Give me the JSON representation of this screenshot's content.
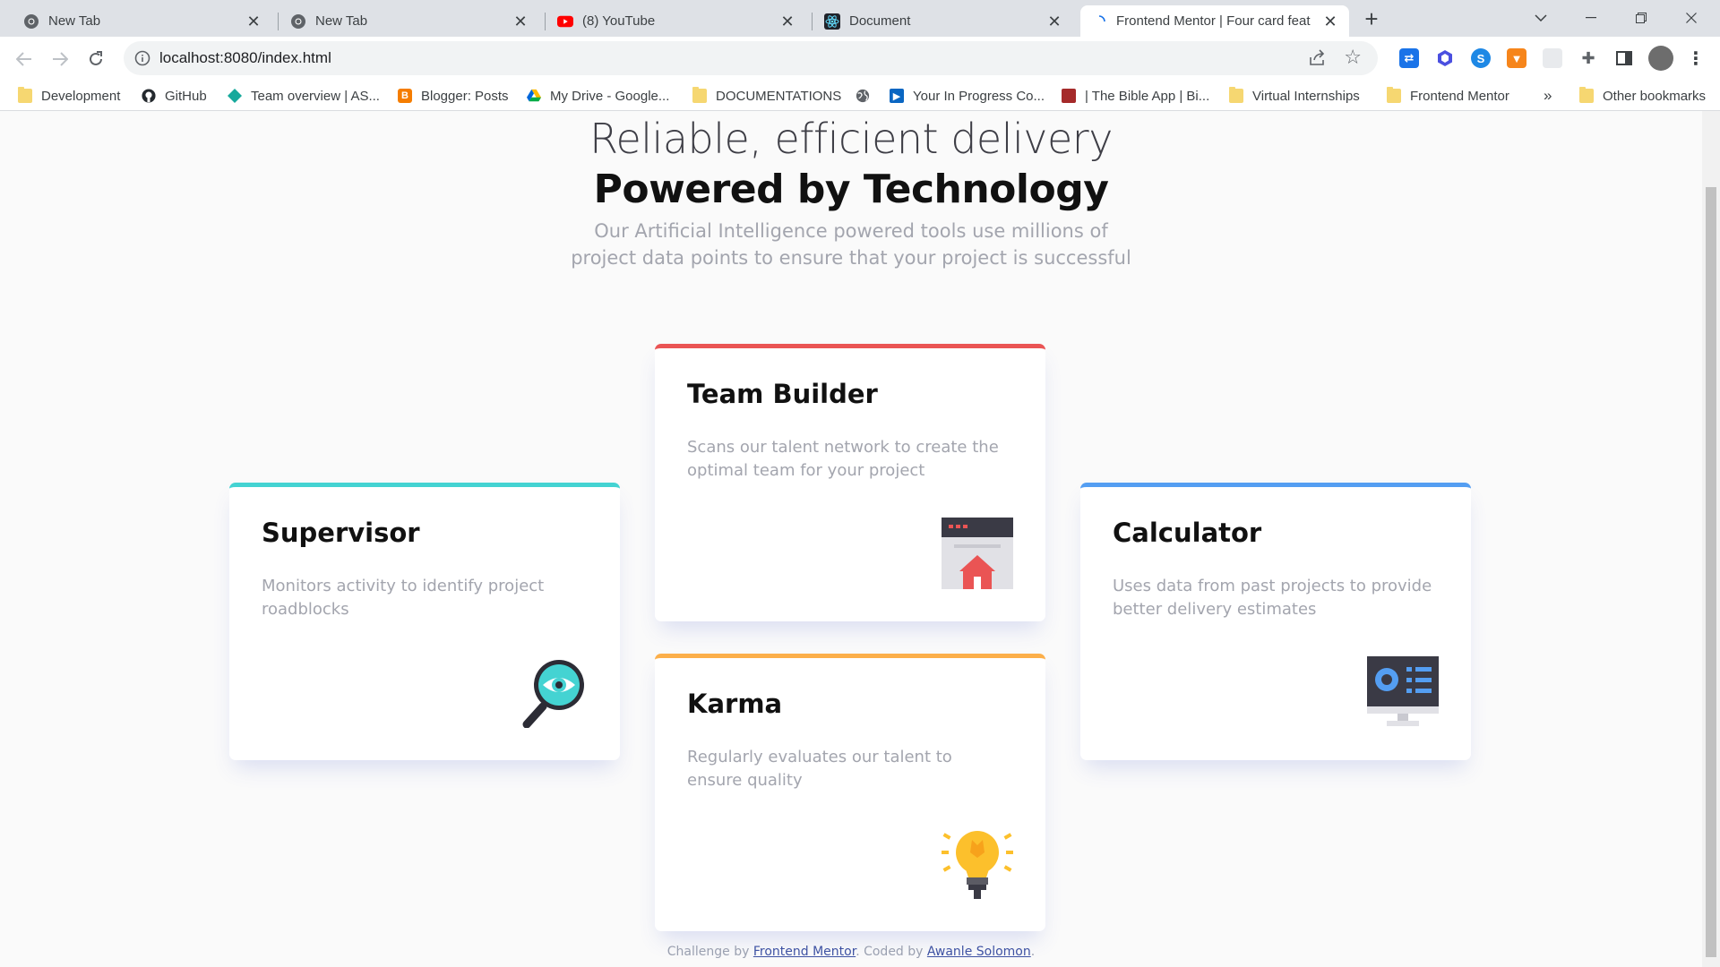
{
  "browser": {
    "tabs": [
      {
        "title": "New Tab",
        "icon": "chrome-icon"
      },
      {
        "title": "New Tab",
        "icon": "chrome-icon"
      },
      {
        "title": "(8) YouTube",
        "icon": "youtube-icon"
      },
      {
        "title": "Document",
        "icon": "react-icon"
      },
      {
        "title": "Frontend Mentor | Four card feat",
        "icon": "loading-icon",
        "active": true
      }
    ],
    "url": "localhost:8080/index.html",
    "bookmarks": [
      {
        "label": "Development",
        "icon": "folder-icon"
      },
      {
        "label": "GitHub",
        "icon": "github-icon"
      },
      {
        "label": "Team overview | AS...",
        "icon": "diamond-icon"
      },
      {
        "label": "Blogger: Posts",
        "icon": "blogger-icon"
      },
      {
        "label": "My Drive - Google...",
        "icon": "drive-icon"
      },
      {
        "label": "DOCUMENTATIONS",
        "icon": "folder-icon"
      },
      {
        "label": "",
        "icon": "globe-icon"
      },
      {
        "label": "Your In Progress Co...",
        "icon": "video-icon"
      },
      {
        "label": "| The Bible App | Bi...",
        "icon": "bible-icon"
      },
      {
        "label": "Virtual Internships",
        "icon": "folder-icon"
      },
      {
        "label": "Frontend Mentor",
        "icon": "folder-icon"
      }
    ],
    "overflow_label": "»",
    "other_bookmarks": "Other bookmarks"
  },
  "page": {
    "hero_line1": "Reliable, efficient delivery",
    "hero_line2": "Powered by Technology",
    "hero_desc": "Our Artificial Intelligence powered tools use millions of project data points to ensure that your project is successful",
    "cards": {
      "supervisor": {
        "title": "Supervisor",
        "text": "Monitors activity to identify project roadblocks",
        "accent": "#44d3d2",
        "icon": "magnifier-eye-icon"
      },
      "team_builder": {
        "title": "Team Builder",
        "text": "Scans our talent network to create the optimal team for your project",
        "accent": "#ea5454",
        "icon": "team-builder-icon"
      },
      "karma": {
        "title": "Karma",
        "text": "Regularly evaluates our talent to ensure quality",
        "accent": "#fcaf4a",
        "icon": "lightbulb-icon"
      },
      "calculator": {
        "title": "Calculator",
        "text": "Uses data from past projects to provide better delivery estimates",
        "accent": "#549ef2",
        "icon": "monitor-icon"
      }
    },
    "attribution": {
      "prefix": "Challenge by ",
      "link1": "Frontend Mentor",
      "middle": ". Coded by ",
      "link2": "Awanle Solomon",
      "suffix": "."
    }
  }
}
